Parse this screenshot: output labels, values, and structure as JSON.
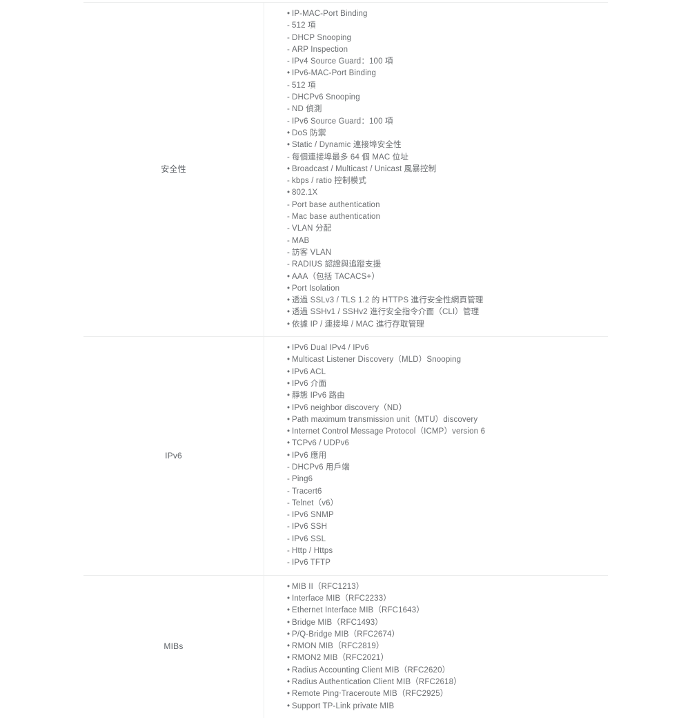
{
  "table": {
    "rows": [
      {
        "label": "安全性",
        "items": [
          {
            "marker": "•",
            "level": "bullet",
            "text": "IP-MAC-Port Binding"
          },
          {
            "marker": "-",
            "level": "dash",
            "text": "512 項"
          },
          {
            "marker": "-",
            "level": "dash",
            "text": "DHCP Snooping"
          },
          {
            "marker": "-",
            "level": "dash",
            "text": "ARP Inspection"
          },
          {
            "marker": "-",
            "level": "dash",
            "text": "IPv4 Source Guard：100 項"
          },
          {
            "marker": "•",
            "level": "bullet",
            "text": "IPv6-MAC-Port Binding"
          },
          {
            "marker": "-",
            "level": "dash",
            "text": "512 項"
          },
          {
            "marker": "-",
            "level": "dash",
            "text": "DHCPv6 Snooping"
          },
          {
            "marker": "-",
            "level": "dash",
            "text": "ND 偵測"
          },
          {
            "marker": "-",
            "level": "dash",
            "text": "IPv6 Source Guard：100 項"
          },
          {
            "marker": "•",
            "level": "bullet",
            "text": "DoS 防禦"
          },
          {
            "marker": "•",
            "level": "bullet",
            "text": "Static / Dynamic 連接埠安全性"
          },
          {
            "marker": "-",
            "level": "dash",
            "text": "每個連接埠最多 64 個 MAC 位址"
          },
          {
            "marker": "•",
            "level": "bullet",
            "text": "Broadcast / Multicast / Unicast 風暴控制"
          },
          {
            "marker": "-",
            "level": "dash",
            "text": "kbps / ratio 控制模式"
          },
          {
            "marker": "•",
            "level": "bullet",
            "text": "802.1X"
          },
          {
            "marker": "-",
            "level": "dash",
            "text": "Port base authentication"
          },
          {
            "marker": "-",
            "level": "dash",
            "text": "Mac base authentication"
          },
          {
            "marker": "-",
            "level": "dash",
            "text": "VLAN 分配"
          },
          {
            "marker": "-",
            "level": "dash",
            "text": "MAB"
          },
          {
            "marker": "-",
            "level": "dash",
            "text": "訪客 VLAN"
          },
          {
            "marker": "-",
            "level": "dash",
            "text": "RADIUS 認證與追蹤支援"
          },
          {
            "marker": "•",
            "level": "bullet",
            "text": "AAA（包括 TACACS+）"
          },
          {
            "marker": "•",
            "level": "bullet",
            "text": "Port Isolation"
          },
          {
            "marker": "•",
            "level": "bullet",
            "text": "透過 SSLv3 / TLS 1.2 的 HTTPS 進行安全性網頁管理"
          },
          {
            "marker": "•",
            "level": "bullet",
            "text": "透過 SSHv1 / SSHv2 進行安全指令介面（CLI）管理"
          },
          {
            "marker": "•",
            "level": "bullet",
            "text": "依據 IP / 連接埠 / MAC 進行存取管理"
          }
        ]
      },
      {
        "label": "IPv6",
        "items": [
          {
            "marker": "•",
            "level": "bullet",
            "text": "IPv6 Dual IPv4 / IPv6"
          },
          {
            "marker": "•",
            "level": "bullet",
            "text": "Multicast Listener Discovery（MLD）Snooping"
          },
          {
            "marker": "•",
            "level": "bullet",
            "text": "IPv6 ACL"
          },
          {
            "marker": "•",
            "level": "bullet",
            "text": "IPv6 介面"
          },
          {
            "marker": "•",
            "level": "bullet",
            "text": "靜態 IPv6 路由"
          },
          {
            "marker": "•",
            "level": "bullet",
            "text": "IPv6 neighbor discovery（ND）"
          },
          {
            "marker": "•",
            "level": "bullet",
            "text": "Path maximum transmission unit（MTU）discovery"
          },
          {
            "marker": "•",
            "level": "bullet",
            "text": "Internet Control Message Protocol（ICMP）version 6"
          },
          {
            "marker": "•",
            "level": "bullet",
            "text": "TCPv6 / UDPv6"
          },
          {
            "marker": "•",
            "level": "bullet",
            "text": "IPv6 應用"
          },
          {
            "marker": "-",
            "level": "dash",
            "text": "DHCPv6 用戶端"
          },
          {
            "marker": "-",
            "level": "dash",
            "text": "Ping6"
          },
          {
            "marker": "-",
            "level": "dash",
            "text": "Tracert6"
          },
          {
            "marker": "-",
            "level": "dash",
            "text": "Telnet（v6）"
          },
          {
            "marker": "-",
            "level": "dash",
            "text": "IPv6 SNMP"
          },
          {
            "marker": "-",
            "level": "dash",
            "text": "IPv6 SSH"
          },
          {
            "marker": "-",
            "level": "dash",
            "text": "IPv6 SSL"
          },
          {
            "marker": "-",
            "level": "dash",
            "text": "Http / Https"
          },
          {
            "marker": "-",
            "level": "dash",
            "text": "IPv6 TFTP"
          }
        ]
      },
      {
        "label": "MIBs",
        "items": [
          {
            "marker": "•",
            "level": "bullet",
            "text": "MIB II（RFC1213）"
          },
          {
            "marker": "•",
            "level": "bullet",
            "text": "Interface MIB（RFC2233）"
          },
          {
            "marker": "•",
            "level": "bullet",
            "text": "Ethernet Interface MIB（RFC1643）"
          },
          {
            "marker": "•",
            "level": "bullet",
            "text": "Bridge MIB（RFC1493）"
          },
          {
            "marker": "•",
            "level": "bullet",
            "text": "P/Q-Bridge MIB（RFC2674）"
          },
          {
            "marker": "•",
            "level": "bullet",
            "text": "RMON MIB（RFC2819）"
          },
          {
            "marker": "•",
            "level": "bullet",
            "text": "RMON2 MIB（RFC2021）"
          },
          {
            "marker": "•",
            "level": "bullet",
            "text": "Radius Accounting Client MIB（RFC2620）"
          },
          {
            "marker": "•",
            "level": "bullet",
            "text": "Radius Authentication Client MIB（RFC2618）"
          },
          {
            "marker": "•",
            "level": "bullet",
            "text": "Remote Ping‧Traceroute MIB（RFC2925）"
          },
          {
            "marker": "•",
            "level": "bullet",
            "text": "Support TP-Link private MIB"
          }
        ]
      }
    ]
  },
  "colors": {
    "text": "#6a6d70",
    "label": "#5f6368",
    "border": "#eceded",
    "background": "#ffffff"
  }
}
